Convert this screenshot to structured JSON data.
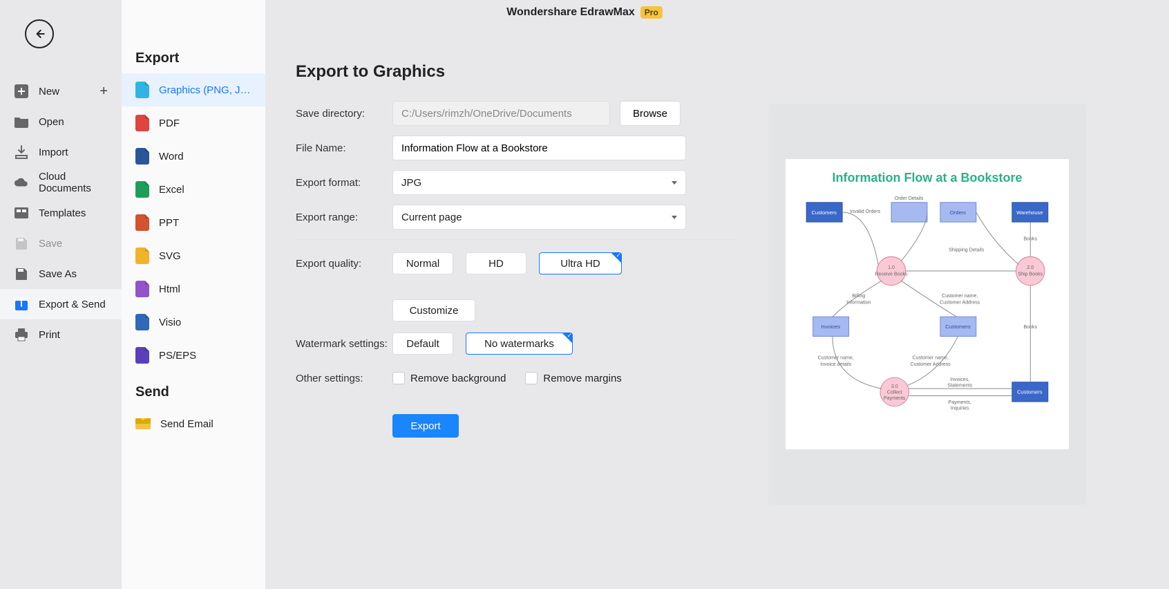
{
  "titlebar": {
    "appname": "Wondershare EdrawMax",
    "badge": "Pro"
  },
  "nav": {
    "items": [
      {
        "label": "New",
        "hasPlus": true
      },
      {
        "label": "Open"
      },
      {
        "label": "Import"
      },
      {
        "label": "Cloud Documents"
      },
      {
        "label": "Templates"
      },
      {
        "label": "Save",
        "disabled": true
      },
      {
        "label": "Save As"
      },
      {
        "label": "Export & Send",
        "active": true
      },
      {
        "label": "Print"
      }
    ]
  },
  "exportList": {
    "heading": "Export",
    "items": [
      {
        "label": "Graphics (PNG, JPG et...",
        "color": "#32b3e6",
        "active": true
      },
      {
        "label": "PDF",
        "color": "#e0443e"
      },
      {
        "label": "Word",
        "color": "#2a5699"
      },
      {
        "label": "Excel",
        "color": "#1d9f5a"
      },
      {
        "label": "PPT",
        "color": "#d35230"
      },
      {
        "label": "SVG",
        "color": "#f0b32c"
      },
      {
        "label": "Html",
        "color": "#9254c8"
      },
      {
        "label": "Visio",
        "color": "#3069b7"
      },
      {
        "label": "PS/EPS",
        "color": "#5b3fb8"
      }
    ]
  },
  "sendList": {
    "heading": "Send",
    "items": [
      {
        "label": "Send Email"
      }
    ]
  },
  "form": {
    "title": "Export to Graphics",
    "saveDirLabel": "Save directory:",
    "saveDirValue": "C:/Users/rimzh/OneDrive/Documents",
    "browse": "Browse",
    "fileNameLabel": "File Name:",
    "fileNameValue": "Information Flow at a Bookstore",
    "formatLabel": "Export format:",
    "formatValue": "JPG",
    "rangeLabel": "Export range:",
    "rangeValue": "Current page",
    "qualityLabel": "Export quality:",
    "quality": {
      "normal": "Normal",
      "hd": "HD",
      "ultra": "Ultra HD",
      "customize": "Customize"
    },
    "watermarkLabel": "Watermark settings:",
    "watermark": {
      "default": "Default",
      "none": "No watermarks"
    },
    "otherLabel": "Other settings:",
    "removeBg": "Remove background",
    "removeMargins": "Remove margins",
    "exportBtn": "Export"
  },
  "preview": {
    "title": "Information Flow at a Bookstore",
    "nodes": {
      "customers": "Customers",
      "orderDetails": "Order Details",
      "orders": "Orders",
      "warehouse": "Warehouse",
      "invalidOrders": "Invalid Orders",
      "receiveBooks": "1.0\nReceive Books",
      "shipBooks": "2.0\nShip Books",
      "books": "Books",
      "billing": "Billing\nInformation",
      "custName": "Customer name,\nCustomer Address",
      "shipping": "Shipping Details",
      "invoices": "Invoices",
      "customers2": "Customers",
      "custInvoice": "Customer name,\nInvoice details",
      "custAddr": "Customer name,\nCustomer Address",
      "collect": "3.0\nCollect\nPayments",
      "invoStmt": "Invoices,\nStatements",
      "payInq": "Payments,\nInquiries",
      "customers3": "Customers"
    }
  }
}
